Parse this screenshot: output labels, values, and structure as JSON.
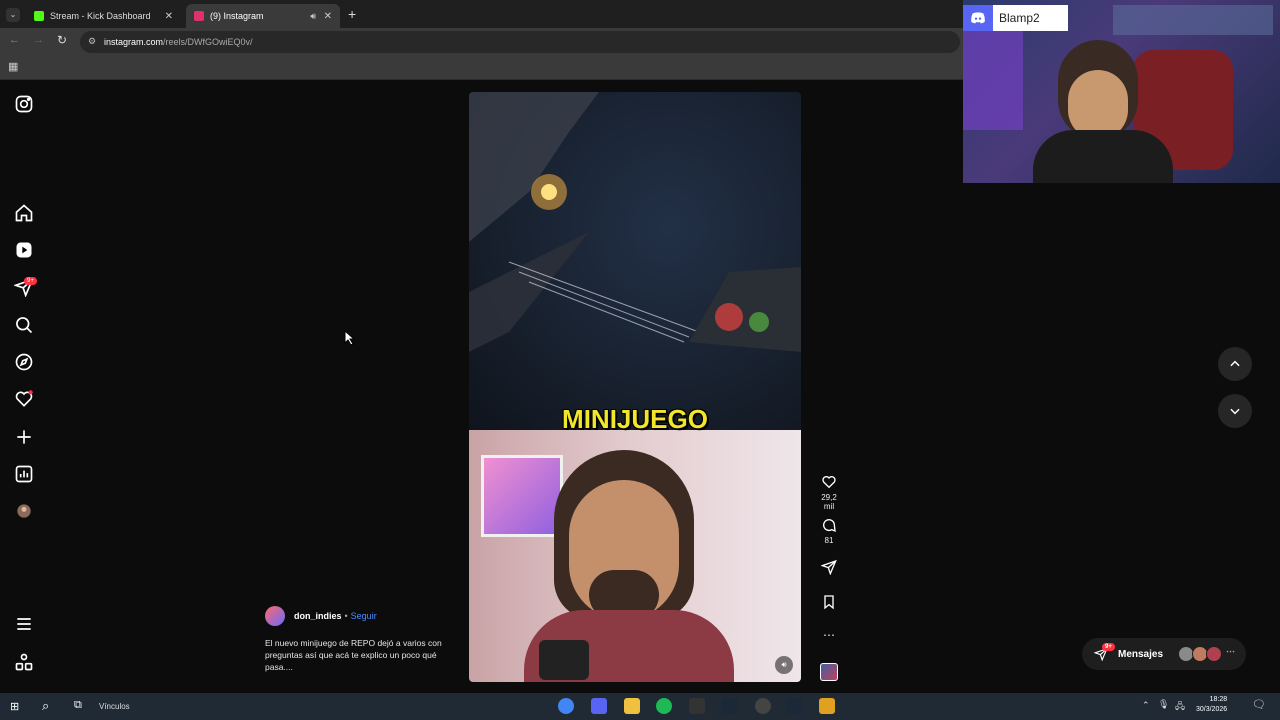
{
  "browser": {
    "tabs": [
      {
        "title": "Stream - Kick Dashboard",
        "favicon_color": "#53fc18"
      },
      {
        "title": "(9) Instagram",
        "favicon_color": "#e1306c"
      }
    ],
    "url_host": "instagram.com",
    "url_path": "/reels/DWfGOwiEQ0v/"
  },
  "sidebar": {
    "notification_badge": "9+",
    "items": [
      "instagram-logo",
      "home",
      "reels",
      "messages",
      "search",
      "explore",
      "notifications",
      "create",
      "dashboard",
      "profile",
      "more",
      "also-from-meta"
    ]
  },
  "reel": {
    "caption_word": "MINIJUEGO",
    "author": "don_indies",
    "separator": "•",
    "follow_label": "Seguir",
    "description": "El nuevo minijuego de REPO dejó a varios con preguntas así que acá te explico un poco qué pasa....",
    "likes": "29,2 mil",
    "comments": "81"
  },
  "messages": {
    "label": "Mensajes",
    "badge": "9+"
  },
  "overlay": {
    "discord_name": "Blamp2"
  },
  "taskbar": {
    "links_label": "Vínculos",
    "time": "18:28",
    "date": "30/3/2026"
  },
  "colors": {
    "accent_blue": "#4f8bff",
    "badge_red": "#ff3040",
    "caption_yellow": "#f2e62b"
  }
}
